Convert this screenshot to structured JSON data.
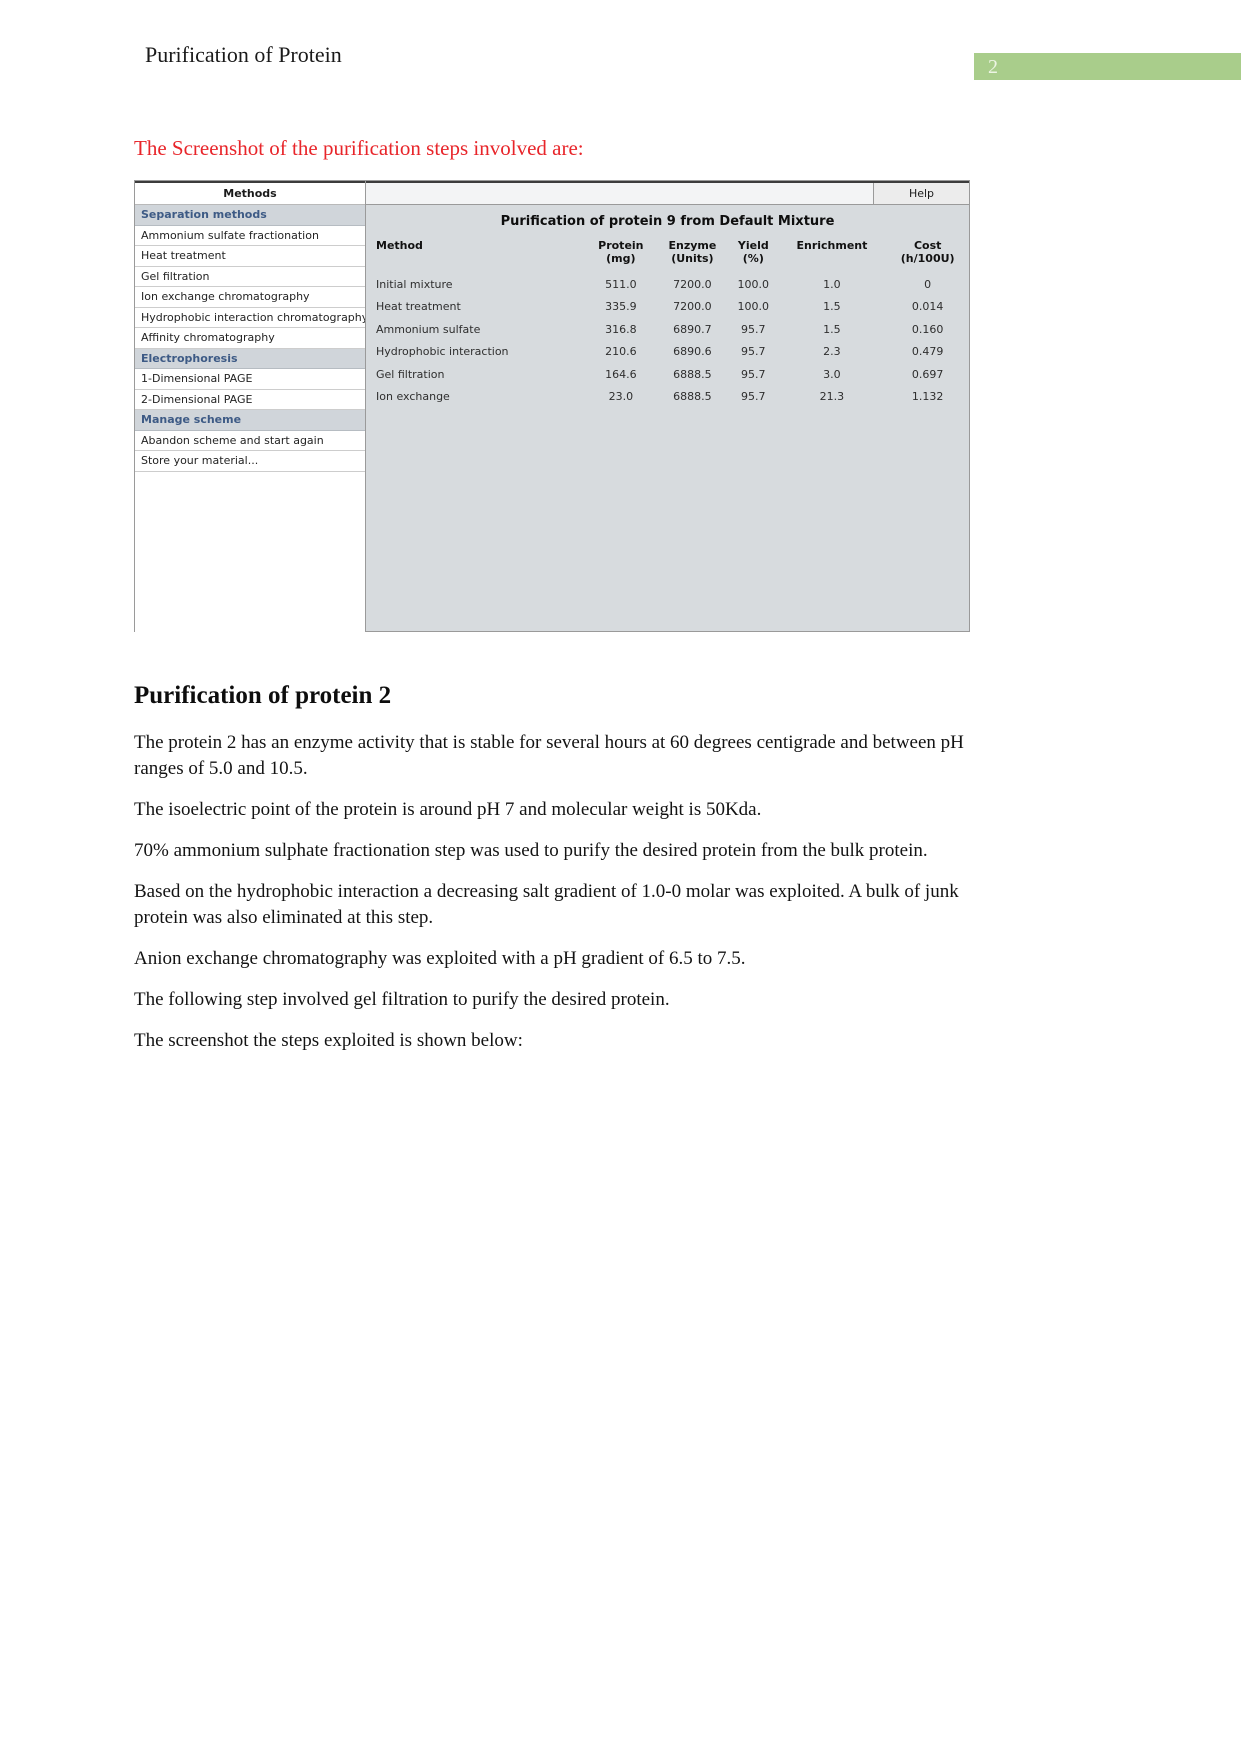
{
  "header": {
    "title": "Purification of Protein",
    "page_number": "2",
    "badge_color": "#a9cd8b"
  },
  "red_heading": {
    "text": "The Screenshot of the purification steps involved are:",
    "color": "#e8252a"
  },
  "screenshot": {
    "sidebar": {
      "header": "Methods",
      "items": [
        {
          "label": "Separation methods",
          "type": "section"
        },
        {
          "label": "Ammonium sulfate fractionation",
          "type": "item"
        },
        {
          "label": "Heat treatment",
          "type": "item"
        },
        {
          "label": "Gel filtration",
          "type": "item"
        },
        {
          "label": "Ion exchange chromatography",
          "type": "item"
        },
        {
          "label": "Hydrophobic interaction chromatography",
          "type": "item"
        },
        {
          "label": "Affinity chromatography",
          "type": "item"
        },
        {
          "label": "Electrophoresis",
          "type": "section"
        },
        {
          "label": "1-Dimensional PAGE",
          "type": "item"
        },
        {
          "label": "2-Dimensional PAGE",
          "type": "item"
        },
        {
          "label": "Manage scheme",
          "type": "section"
        },
        {
          "label": "Abandon scheme and start again",
          "type": "item"
        },
        {
          "label": "Store your material...",
          "type": "item"
        }
      ]
    },
    "toolbar": {
      "help_label": "Help"
    },
    "table_title": "Purification of protein 9 from Default Mixture",
    "table": {
      "columns": [
        {
          "name": "Method",
          "unit": ""
        },
        {
          "name": "Protein",
          "unit": "(mg)"
        },
        {
          "name": "Enzyme",
          "unit": "(Units)"
        },
        {
          "name": "Yield",
          "unit": "(%)"
        },
        {
          "name": "Enrichment",
          "unit": ""
        },
        {
          "name": "Cost",
          "unit": "(h/100U)"
        }
      ],
      "rows": [
        {
          "method": "Initial mixture",
          "protein": "511.0",
          "enzyme": "7200.0",
          "yield": "100.0",
          "enrichment": "1.0",
          "cost": "0"
        },
        {
          "method": "Heat treatment",
          "protein": "335.9",
          "enzyme": "7200.0",
          "yield": "100.0",
          "enrichment": "1.5",
          "cost": "0.014"
        },
        {
          "method": "Ammonium sulfate",
          "protein": "316.8",
          "enzyme": "6890.7",
          "yield": "95.7",
          "enrichment": "1.5",
          "cost": "0.160"
        },
        {
          "method": "Hydrophobic interaction",
          "protein": "210.6",
          "enzyme": "6890.6",
          "yield": "95.7",
          "enrichment": "2.3",
          "cost": "0.479"
        },
        {
          "method": "Gel filtration",
          "protein": "164.6",
          "enzyme": "6888.5",
          "yield": "95.7",
          "enrichment": "3.0",
          "cost": "0.697"
        },
        {
          "method": "Ion exchange",
          "protein": "23.0",
          "enzyme": "6888.5",
          "yield": "95.7",
          "enrichment": "21.3",
          "cost": "1.132"
        }
      ]
    }
  },
  "body": {
    "section_title": "Purification of protein 2",
    "paragraphs": [
      "The protein 2 has an enzyme activity that is stable for several hours at 60 degrees centigrade and between pH ranges of 5.0 and 10.5.",
      "The isoelectric point of the protein is around pH 7 and molecular weight is 50Kda.",
      "70% ammonium sulphate fractionation step was used to purify the desired protein from the bulk protein.",
      "Based on the hydrophobic interaction a decreasing salt gradient of 1.0-0 molar was exploited. A bulk of junk protein was also eliminated at this step.",
      "Anion exchange chromatography was exploited with a pH gradient of 6.5 to 7.5.",
      "The following step involved gel filtration to purify the desired protein.",
      "The screenshot the steps exploited is shown below:"
    ]
  }
}
